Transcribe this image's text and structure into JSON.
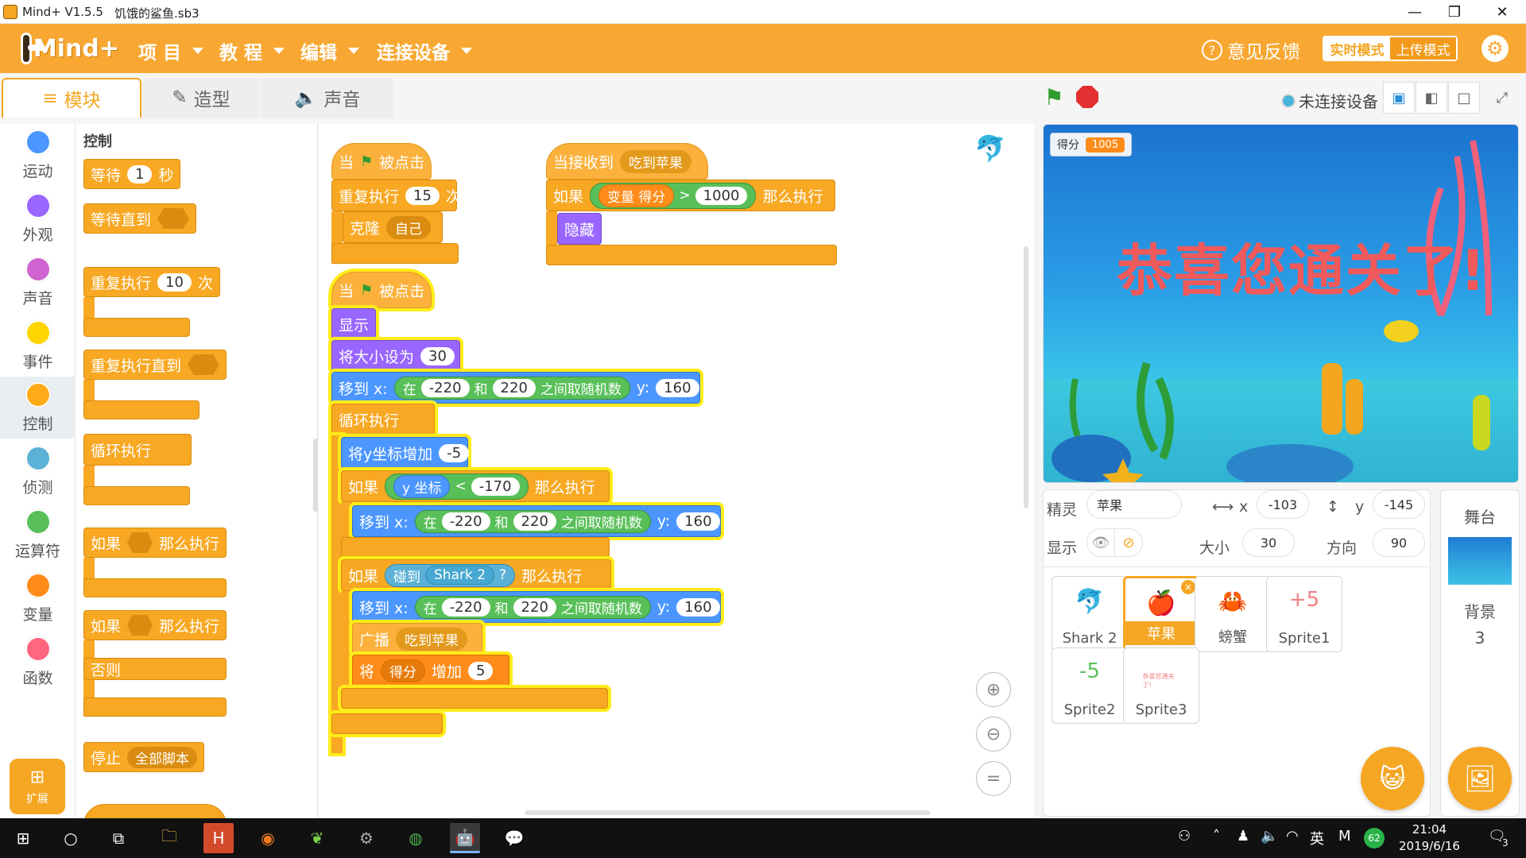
{
  "window": {
    "app_title": "Mind+ V1.5.5",
    "file_name": "饥饿的鲨鱼.sb3",
    "minimize": "—",
    "restore": "❐",
    "close": "✕"
  },
  "menubar": {
    "logo_text": "Mind+",
    "menus": [
      "项 目",
      "教 程",
      "编辑",
      "连接设备"
    ],
    "feedback": "意见反馈",
    "mode_realtime": "实时模式",
    "mode_upload": "上传模式"
  },
  "tabs": {
    "blocks": "模块",
    "costumes": "造型",
    "sounds": "声音"
  },
  "connection": "未连接设备",
  "categories": [
    {
      "label": "运动",
      "color": "#4c97ff"
    },
    {
      "label": "外观",
      "color": "#9966ff"
    },
    {
      "label": "声音",
      "color": "#cf63cf"
    },
    {
      "label": "事件",
      "color": "#ffd500"
    },
    {
      "label": "控制",
      "color": "#ffab19"
    },
    {
      "label": "侦测",
      "color": "#5cb1d6"
    },
    {
      "label": "运算符",
      "color": "#59c059"
    },
    {
      "label": "变量",
      "color": "#ff8c1a"
    },
    {
      "label": "函数",
      "color": "#ff6680"
    }
  ],
  "extension": "扩展",
  "palette": {
    "header": "控制",
    "wait": "等待",
    "wait_val": "1",
    "wait_unit": "秒",
    "wait_until": "等待直到",
    "repeat": "重复执行",
    "repeat_val": "10",
    "repeat_unit": "次",
    "repeat_until": "重复执行直到",
    "forever": "循环执行",
    "if": "如果",
    "then": "那么执行",
    "if2": "如果",
    "then2": "那么执行",
    "else": "否则",
    "stop": "停止",
    "stop_opt": "全部脚本"
  },
  "script1": {
    "when": "当",
    "clicked": "被点击",
    "repeat": "重复执行",
    "repeat_val": "15",
    "times": "次",
    "clone": "克隆",
    "clone_opt": "自己"
  },
  "script2": {
    "receive": "当接收到",
    "msg": "吃到苹果",
    "if": "如果",
    "var_label": "变量",
    "var_name": "得分",
    "op": ">",
    "val": "1000",
    "then": "那么执行",
    "hide": "隐藏"
  },
  "script3": {
    "when": "当",
    "clicked": "被点击",
    "show": "显示",
    "setsize": "将大小设为",
    "size": "30",
    "goto": "移到 x:",
    "in": "在",
    "min": "-220",
    "and": "和",
    "max": "220",
    "rand": "之间取随机数",
    "ylab": "y:",
    "y": "160",
    "forever": "循环执行",
    "changey": "将y坐标增加",
    "dy": "-5",
    "if1": "如果",
    "ypos": "y 坐标",
    "lt": "<",
    "lim": "-170",
    "then1": "那么执行",
    "goto2": "移到 x:",
    "in2": "在",
    "min2": "-220",
    "and2": "和",
    "max2": "220",
    "rand2": "之间取随机数",
    "ylab2": "y:",
    "y2": "160",
    "if2": "如果",
    "touch": "碰到",
    "target": "Shark 2",
    "q": "?",
    "then2": "那么执行",
    "goto3": "移到 x:",
    "in3": "在",
    "min3": "-220",
    "and3": "和",
    "max3": "220",
    "rand3": "之间取随机数",
    "ylab3": "y:",
    "y3": "160",
    "broadcast": "广播",
    "bmsg": "吃到苹果",
    "change": "将",
    "cvar": "得分",
    "by": "增加",
    "amt": "5"
  },
  "stage": {
    "score_label": "得分",
    "score_value": "1005",
    "message": "恭喜您通关了!"
  },
  "sprite_info": {
    "sprite_label": "精灵",
    "sprite_name": "苹果",
    "x_label": "x",
    "x": "-103",
    "y_label": "y",
    "y": "-145",
    "show_label": "显示",
    "size_label": "大小",
    "size": "30",
    "dir_label": "方向",
    "dir": "90"
  },
  "sprites": [
    {
      "name": "Shark 2",
      "pic": "🐬"
    },
    {
      "name": "苹果",
      "pic": "🍎"
    },
    {
      "name": "螃蟹",
      "pic": "🦀"
    },
    {
      "name": "Sprite1",
      "pic": "+5"
    },
    {
      "name": "Sprite2",
      "pic": "-5"
    },
    {
      "name": "Sprite3",
      "pic": "恭喜您通关了!"
    }
  ],
  "stage_panel": {
    "title": "舞台",
    "backdrop_label": "背景",
    "backdrop_count": "3"
  },
  "taskbar": {
    "time": "21:04",
    "date": "2019/6/16",
    "lang": "英",
    "badge": "62",
    "notif": "3"
  }
}
